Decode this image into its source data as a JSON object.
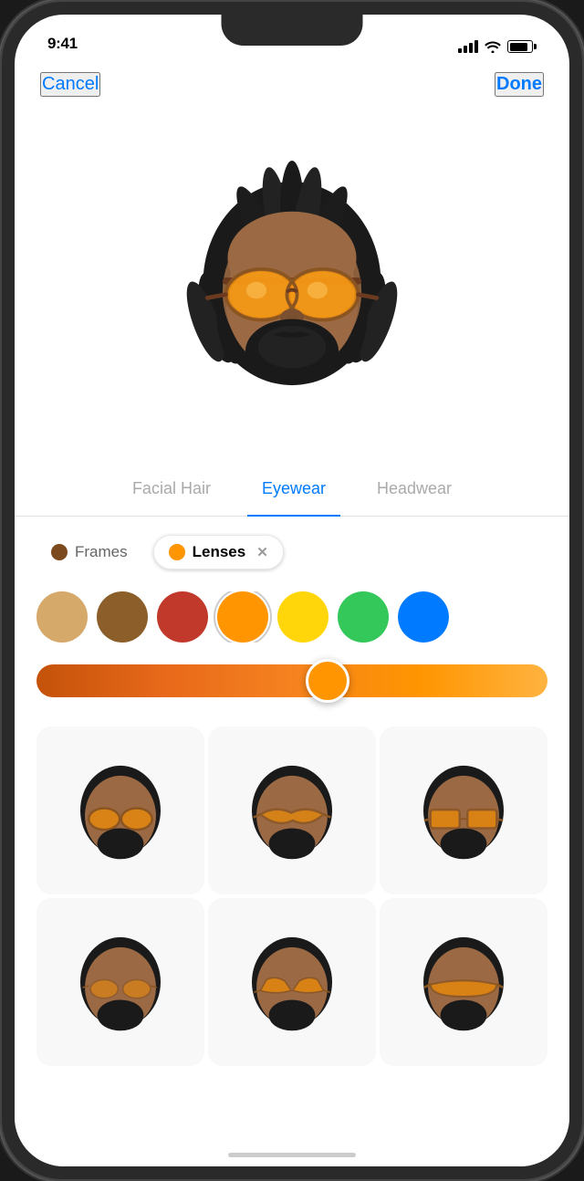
{
  "status_bar": {
    "time": "9:41",
    "signal_bars": [
      6,
      9,
      11,
      14
    ],
    "wifi": "wifi",
    "battery_level": 85
  },
  "nav": {
    "cancel_label": "Cancel",
    "done_label": "Done"
  },
  "tabs": [
    {
      "id": "facial-hair",
      "label": "Facial Hair",
      "active": false
    },
    {
      "id": "eyewear",
      "label": "Eyewear",
      "active": true
    },
    {
      "id": "headwear",
      "label": "Headwear",
      "active": false
    }
  ],
  "filters": [
    {
      "id": "frames",
      "label": "Frames",
      "active": false,
      "color": "#7B4A1E"
    },
    {
      "id": "lenses",
      "label": "Lenses",
      "active": true,
      "color": "#FF9500"
    }
  ],
  "color_swatches": [
    {
      "id": "swatch-tan",
      "color": "#D4A96A",
      "selected": false
    },
    {
      "id": "swatch-brown",
      "color": "#8B4513",
      "selected": false
    },
    {
      "id": "swatch-red",
      "color": "#C0392B",
      "selected": false
    },
    {
      "id": "swatch-orange",
      "color": "#FF9500",
      "selected": true
    },
    {
      "id": "swatch-yellow",
      "color": "#FFD60A",
      "selected": false
    },
    {
      "id": "swatch-green",
      "color": "#34C759",
      "selected": false
    },
    {
      "id": "swatch-blue",
      "color": "#007AFF",
      "selected": false
    }
  ],
  "slider": {
    "value": 57,
    "gradient_start": "#8B3A00",
    "gradient_end": "#FFCC00"
  },
  "emoji_grid": [
    {
      "id": "memoji-1",
      "style": "round-frames"
    },
    {
      "id": "memoji-2",
      "style": "aviator"
    },
    {
      "id": "memoji-3",
      "style": "square-frames"
    },
    {
      "id": "memoji-4",
      "style": "thin-frames"
    },
    {
      "id": "memoji-5",
      "style": "cat-eye"
    },
    {
      "id": "memoji-6",
      "style": "visor"
    }
  ],
  "colors": {
    "accent": "#007AFF",
    "active_tab": "#007AFF",
    "inactive_tab": "#AAAAAA",
    "filter_active_bg": "#FFFFFF",
    "slider_color": "#FF9500"
  }
}
